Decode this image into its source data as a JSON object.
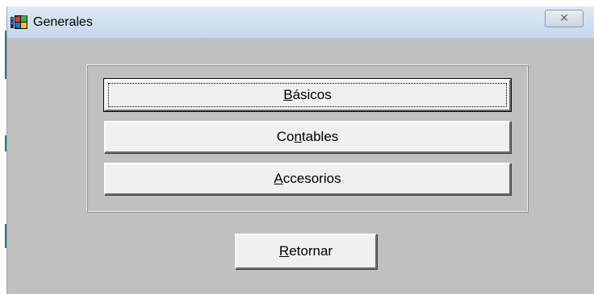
{
  "window": {
    "title": "Generales",
    "close_glyph": "✕"
  },
  "icons": {
    "app": "app-window-icon",
    "close": "close-icon"
  },
  "buttons": {
    "basicos": {
      "pre": "",
      "key": "B",
      "post": "ásicos"
    },
    "contables": {
      "pre": "Co",
      "key": "n",
      "post": "tables"
    },
    "accesorios": {
      "pre": "",
      "key": "A",
      "post": "ccesorios"
    },
    "retornar": {
      "pre": "",
      "key": "R",
      "post": "etornar"
    }
  },
  "colors": {
    "dialog_bg": "#c0c0c0",
    "titlebar": "#d4e2f2",
    "button_face": "#f0f0f0"
  }
}
